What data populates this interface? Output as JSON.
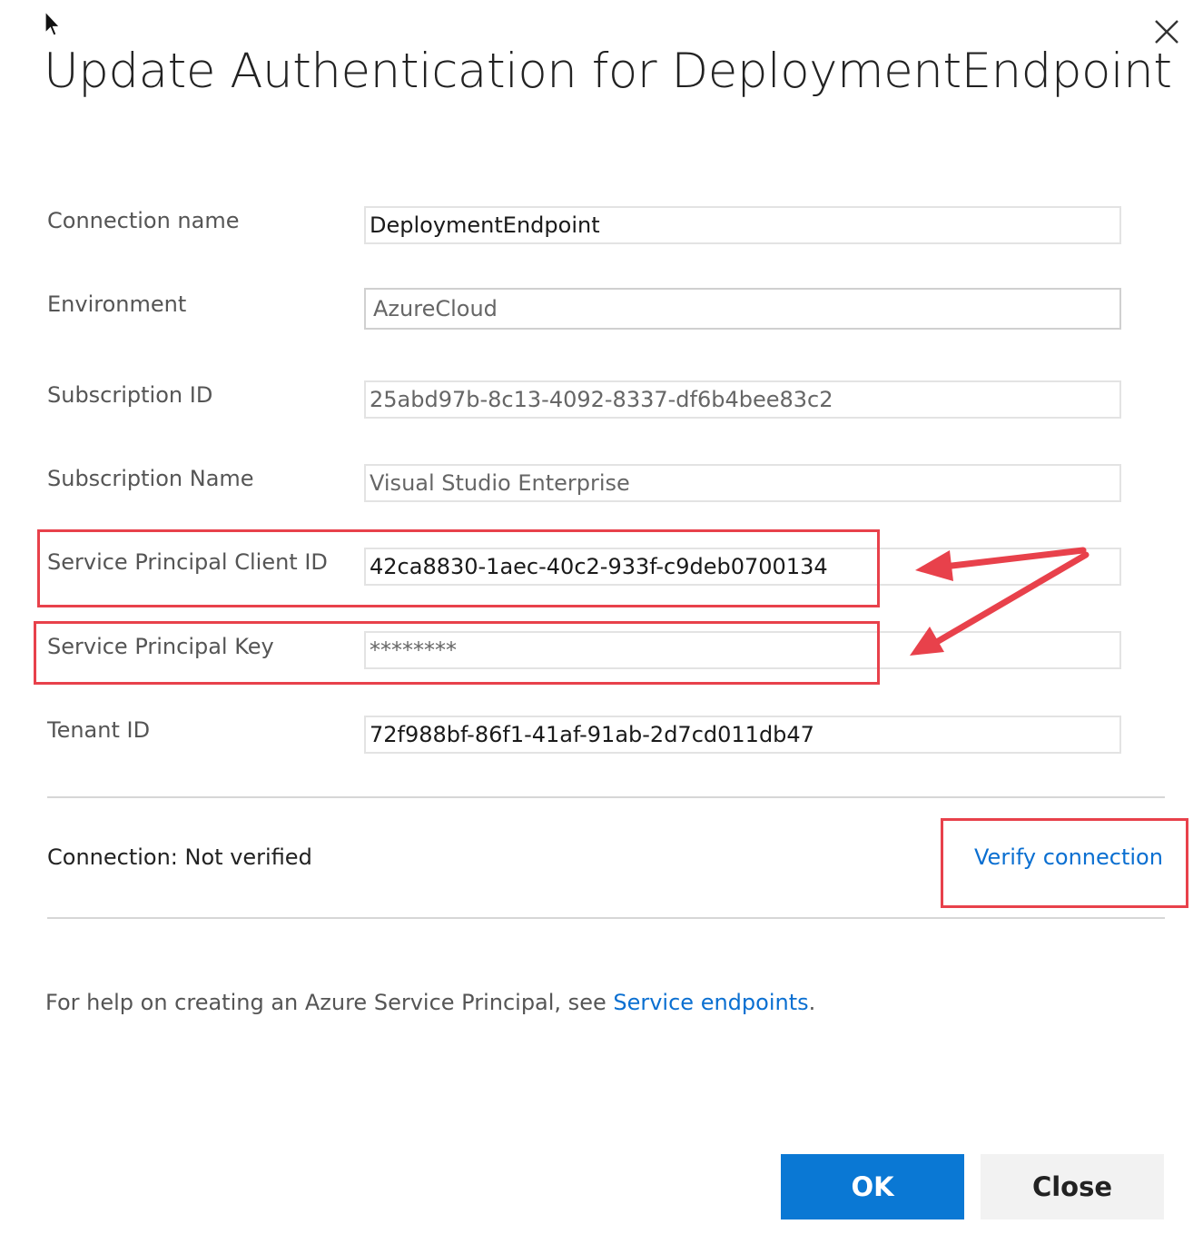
{
  "dialog": {
    "title": "Update Authentication for DeploymentEndpoint",
    "close_icon": "close-x-icon"
  },
  "fields": {
    "connection_name": {
      "label": "Connection name",
      "value": "DeploymentEndpoint"
    },
    "environment": {
      "label": "Environment",
      "value": "AzureCloud"
    },
    "subscription_id": {
      "label": "Subscription ID",
      "value": "25abd97b-8c13-4092-8337-df6b4bee83c2"
    },
    "subscription_name": {
      "label": "Subscription Name",
      "value": "Visual Studio Enterprise"
    },
    "sp_client_id": {
      "label": "Service Principal Client ID",
      "value": "42ca8830-1aec-40c2-933f-c9deb0700134"
    },
    "sp_key": {
      "label": "Service Principal Key",
      "value": "********"
    },
    "tenant_id": {
      "label": "Tenant ID",
      "value": "72f988bf-86f1-41af-91ab-2d7cd011db47"
    }
  },
  "connection": {
    "status_text": "Connection:  Not verified",
    "verify_label": "Verify connection"
  },
  "help": {
    "prefix": "For help on creating an Azure Service Principal, see ",
    "link_label": "Service endpoints",
    "suffix": "."
  },
  "buttons": {
    "ok_label": "OK",
    "close_label": "Close"
  },
  "colors": {
    "accent": "#0a78d4",
    "link": "#0a6fd1",
    "annotation": "#e8414b"
  }
}
